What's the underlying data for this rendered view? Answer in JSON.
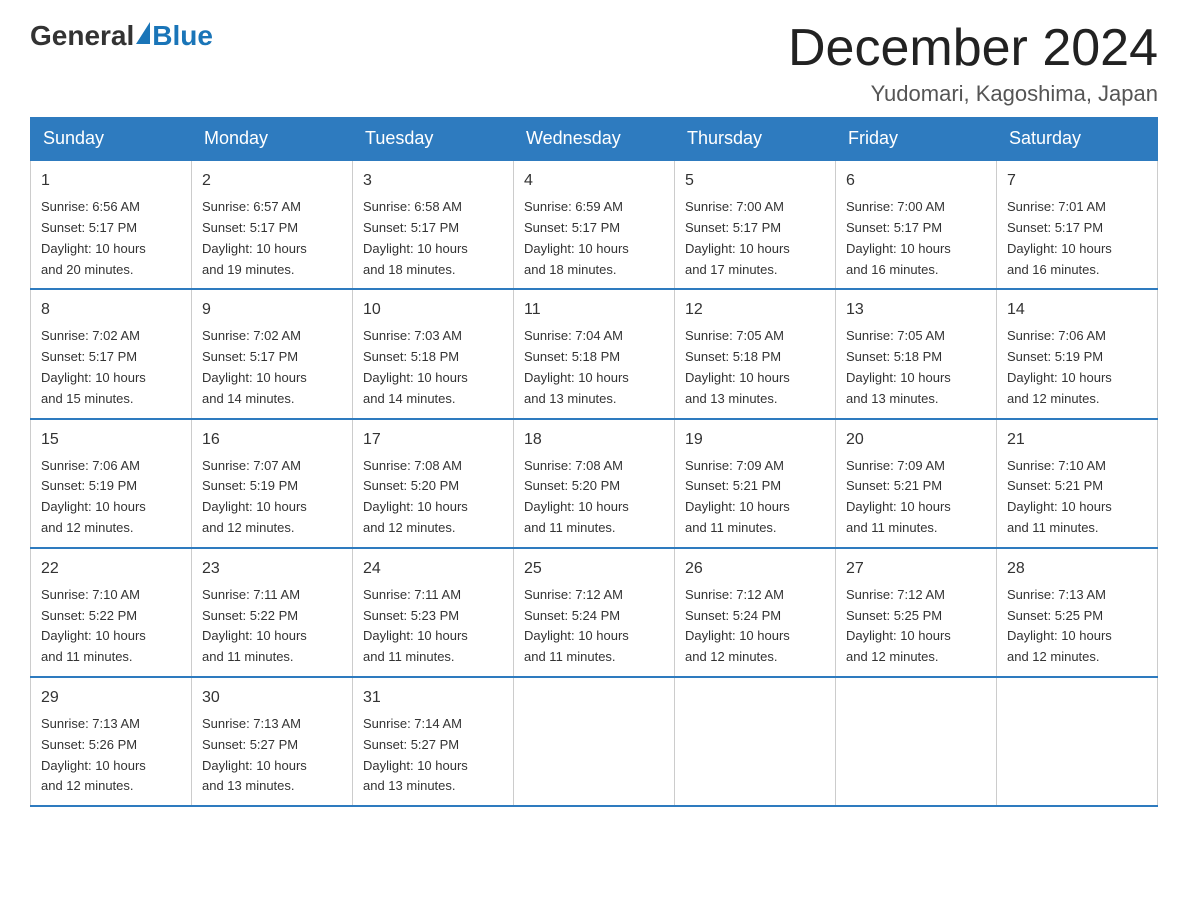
{
  "header": {
    "logo_general": "General",
    "logo_blue": "Blue",
    "title": "December 2024",
    "location": "Yudomari, Kagoshima, Japan"
  },
  "days_of_week": [
    "Sunday",
    "Monday",
    "Tuesday",
    "Wednesday",
    "Thursday",
    "Friday",
    "Saturday"
  ],
  "weeks": [
    [
      {
        "day": "1",
        "sunrise": "6:56 AM",
        "sunset": "5:17 PM",
        "daylight": "10 hours and 20 minutes."
      },
      {
        "day": "2",
        "sunrise": "6:57 AM",
        "sunset": "5:17 PM",
        "daylight": "10 hours and 19 minutes."
      },
      {
        "day": "3",
        "sunrise": "6:58 AM",
        "sunset": "5:17 PM",
        "daylight": "10 hours and 18 minutes."
      },
      {
        "day": "4",
        "sunrise": "6:59 AM",
        "sunset": "5:17 PM",
        "daylight": "10 hours and 18 minutes."
      },
      {
        "day": "5",
        "sunrise": "7:00 AM",
        "sunset": "5:17 PM",
        "daylight": "10 hours and 17 minutes."
      },
      {
        "day": "6",
        "sunrise": "7:00 AM",
        "sunset": "5:17 PM",
        "daylight": "10 hours and 16 minutes."
      },
      {
        "day": "7",
        "sunrise": "7:01 AM",
        "sunset": "5:17 PM",
        "daylight": "10 hours and 16 minutes."
      }
    ],
    [
      {
        "day": "8",
        "sunrise": "7:02 AM",
        "sunset": "5:17 PM",
        "daylight": "10 hours and 15 minutes."
      },
      {
        "day": "9",
        "sunrise": "7:02 AM",
        "sunset": "5:17 PM",
        "daylight": "10 hours and 14 minutes."
      },
      {
        "day": "10",
        "sunrise": "7:03 AM",
        "sunset": "5:18 PM",
        "daylight": "10 hours and 14 minutes."
      },
      {
        "day": "11",
        "sunrise": "7:04 AM",
        "sunset": "5:18 PM",
        "daylight": "10 hours and 13 minutes."
      },
      {
        "day": "12",
        "sunrise": "7:05 AM",
        "sunset": "5:18 PM",
        "daylight": "10 hours and 13 minutes."
      },
      {
        "day": "13",
        "sunrise": "7:05 AM",
        "sunset": "5:18 PM",
        "daylight": "10 hours and 13 minutes."
      },
      {
        "day": "14",
        "sunrise": "7:06 AM",
        "sunset": "5:19 PM",
        "daylight": "10 hours and 12 minutes."
      }
    ],
    [
      {
        "day": "15",
        "sunrise": "7:06 AM",
        "sunset": "5:19 PM",
        "daylight": "10 hours and 12 minutes."
      },
      {
        "day": "16",
        "sunrise": "7:07 AM",
        "sunset": "5:19 PM",
        "daylight": "10 hours and 12 minutes."
      },
      {
        "day": "17",
        "sunrise": "7:08 AM",
        "sunset": "5:20 PM",
        "daylight": "10 hours and 12 minutes."
      },
      {
        "day": "18",
        "sunrise": "7:08 AM",
        "sunset": "5:20 PM",
        "daylight": "10 hours and 11 minutes."
      },
      {
        "day": "19",
        "sunrise": "7:09 AM",
        "sunset": "5:21 PM",
        "daylight": "10 hours and 11 minutes."
      },
      {
        "day": "20",
        "sunrise": "7:09 AM",
        "sunset": "5:21 PM",
        "daylight": "10 hours and 11 minutes."
      },
      {
        "day": "21",
        "sunrise": "7:10 AM",
        "sunset": "5:21 PM",
        "daylight": "10 hours and 11 minutes."
      }
    ],
    [
      {
        "day": "22",
        "sunrise": "7:10 AM",
        "sunset": "5:22 PM",
        "daylight": "10 hours and 11 minutes."
      },
      {
        "day": "23",
        "sunrise": "7:11 AM",
        "sunset": "5:22 PM",
        "daylight": "10 hours and 11 minutes."
      },
      {
        "day": "24",
        "sunrise": "7:11 AM",
        "sunset": "5:23 PM",
        "daylight": "10 hours and 11 minutes."
      },
      {
        "day": "25",
        "sunrise": "7:12 AM",
        "sunset": "5:24 PM",
        "daylight": "10 hours and 11 minutes."
      },
      {
        "day": "26",
        "sunrise": "7:12 AM",
        "sunset": "5:24 PM",
        "daylight": "10 hours and 12 minutes."
      },
      {
        "day": "27",
        "sunrise": "7:12 AM",
        "sunset": "5:25 PM",
        "daylight": "10 hours and 12 minutes."
      },
      {
        "day": "28",
        "sunrise": "7:13 AM",
        "sunset": "5:25 PM",
        "daylight": "10 hours and 12 minutes."
      }
    ],
    [
      {
        "day": "29",
        "sunrise": "7:13 AM",
        "sunset": "5:26 PM",
        "daylight": "10 hours and 12 minutes."
      },
      {
        "day": "30",
        "sunrise": "7:13 AM",
        "sunset": "5:27 PM",
        "daylight": "10 hours and 13 minutes."
      },
      {
        "day": "31",
        "sunrise": "7:14 AM",
        "sunset": "5:27 PM",
        "daylight": "10 hours and 13 minutes."
      },
      null,
      null,
      null,
      null
    ]
  ],
  "labels": {
    "sunrise": "Sunrise:",
    "sunset": "Sunset:",
    "daylight": "Daylight:"
  }
}
